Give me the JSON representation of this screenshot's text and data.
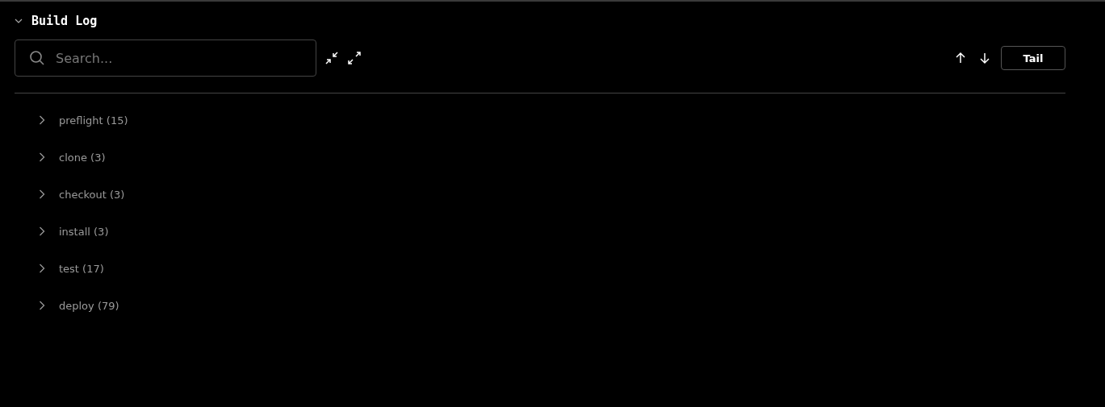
{
  "section": {
    "title": "Build Log",
    "expanded": true
  },
  "search": {
    "placeholder": "Search..."
  },
  "tail_button": "Tail",
  "steps": [
    {
      "label": "preflight (15)",
      "expanded": false
    },
    {
      "label": "clone (3)",
      "expanded": false
    },
    {
      "label": "checkout (3)",
      "expanded": false
    },
    {
      "label": "install (3)",
      "expanded": false
    },
    {
      "label": "test (17)",
      "expanded": false
    },
    {
      "label": "deploy (79)",
      "expanded": false
    }
  ]
}
